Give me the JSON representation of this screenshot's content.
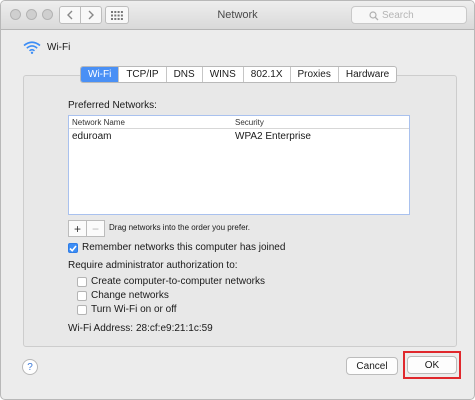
{
  "window": {
    "title": "Network"
  },
  "search": {
    "placeholder": "Search"
  },
  "interface": {
    "label": "Wi-Fi"
  },
  "tabs": [
    {
      "label": "Wi-Fi",
      "active": true
    },
    {
      "label": "TCP/IP"
    },
    {
      "label": "DNS"
    },
    {
      "label": "WINS"
    },
    {
      "label": "802.1X"
    },
    {
      "label": "Proxies"
    },
    {
      "label": "Hardware"
    }
  ],
  "preferred": {
    "label": "Preferred Networks:",
    "columns": {
      "name": "Network Name",
      "security": "Security"
    },
    "rows": [
      {
        "name": "eduroam",
        "security": "WPA2 Enterprise"
      }
    ],
    "add_label": "+",
    "remove_label": "−",
    "hint": "Drag networks into the order you prefer."
  },
  "remember": {
    "label": "Remember networks this computer has joined",
    "checked": true
  },
  "admin": {
    "label": "Require administrator authorization to:",
    "options": [
      {
        "label": "Create computer-to-computer networks",
        "checked": false
      },
      {
        "label": "Change networks",
        "checked": false
      },
      {
        "label": "Turn Wi-Fi on or off",
        "checked": false
      }
    ]
  },
  "address": {
    "label": "Wi-Fi Address:",
    "value": "28:cf:e9:21:1c:59"
  },
  "footer": {
    "help_label": "?",
    "cancel_label": "Cancel",
    "ok_label": "OK"
  },
  "colors": {
    "accent": "#4a90f5",
    "highlight": "#e0282d"
  }
}
